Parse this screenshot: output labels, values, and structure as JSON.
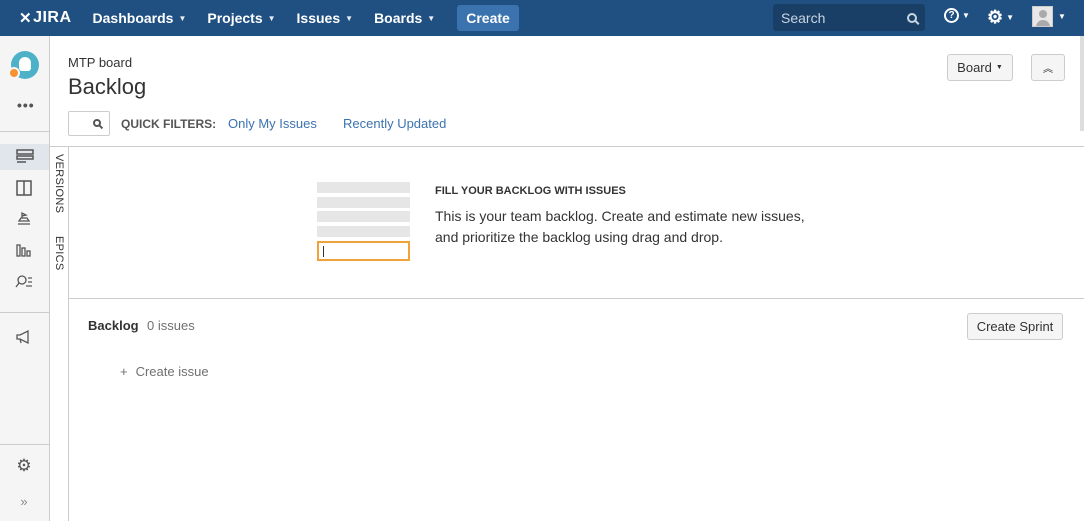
{
  "topnav": {
    "logo": "JIRA",
    "items": [
      {
        "label": "Dashboards"
      },
      {
        "label": "Projects"
      },
      {
        "label": "Issues"
      },
      {
        "label": "Boards"
      }
    ],
    "create_label": "Create",
    "search_placeholder": "Search"
  },
  "header": {
    "breadcrumb": "MTP board",
    "title": "Backlog",
    "board_button": "Board",
    "quick_filters_label": "QUICK FILTERS:",
    "quick_filters": [
      "Only My Issues",
      "Recently Updated"
    ]
  },
  "side_tabs": {
    "versions": "VERSIONS",
    "epics": "EPICS"
  },
  "empty_state": {
    "title": "FILL YOUR BACKLOG WITH ISSUES",
    "text": "This is your team backlog. Create and estimate new issues, and prioritize the backlog using drag and drop."
  },
  "backlog": {
    "title": "Backlog",
    "count": "0 issues",
    "create_sprint": "Create Sprint",
    "create_issue": "Create issue"
  },
  "colors": {
    "nav_bg": "#205081",
    "create_btn": "#3b73af",
    "link": "#3b73af",
    "placeholder_focus": "#f0a33a"
  }
}
